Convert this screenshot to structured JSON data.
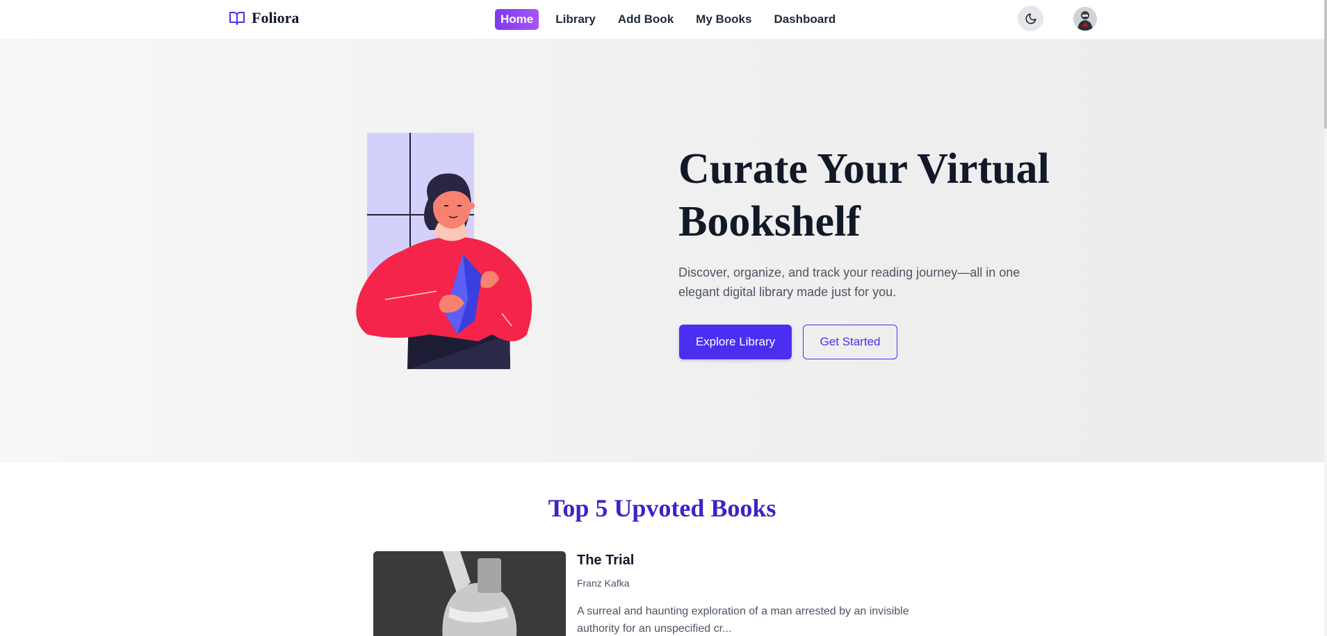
{
  "brand": {
    "name": "Foliora",
    "icon": "book-open-icon",
    "accent": "#4a2ff0"
  },
  "nav": {
    "items": [
      {
        "label": "Home",
        "active": true
      },
      {
        "label": "Library",
        "active": false
      },
      {
        "label": "Add Book",
        "active": false
      },
      {
        "label": "My Books",
        "active": false
      },
      {
        "label": "Dashboard",
        "active": false
      }
    ],
    "theme_toggle_icon": "moon-icon",
    "avatar_icon": "user-avatar"
  },
  "hero": {
    "title": "Curate Your Virtual Bookshelf",
    "description": "Discover, organize, and track your reading journey—all in one elegant digital library made just for you.",
    "primary_button": "Explore Library",
    "secondary_button": "Get Started",
    "illustration": "woman-reading-book-illustration"
  },
  "top_books": {
    "title": "Top 5 Upvoted Books",
    "books": [
      {
        "title": "The Trial",
        "author": "Franz Kafka",
        "description": "A surreal and haunting exploration of a man arrested by an invisible authority for an unspecified cr..."
      }
    ]
  },
  "colors": {
    "primary": "#4a2ff0",
    "active_nav_start": "#7c3aed",
    "active_nav_end": "#a855f7",
    "section_title": "#3b24c7",
    "text_dark": "#111827",
    "text_muted": "#4b5563"
  }
}
